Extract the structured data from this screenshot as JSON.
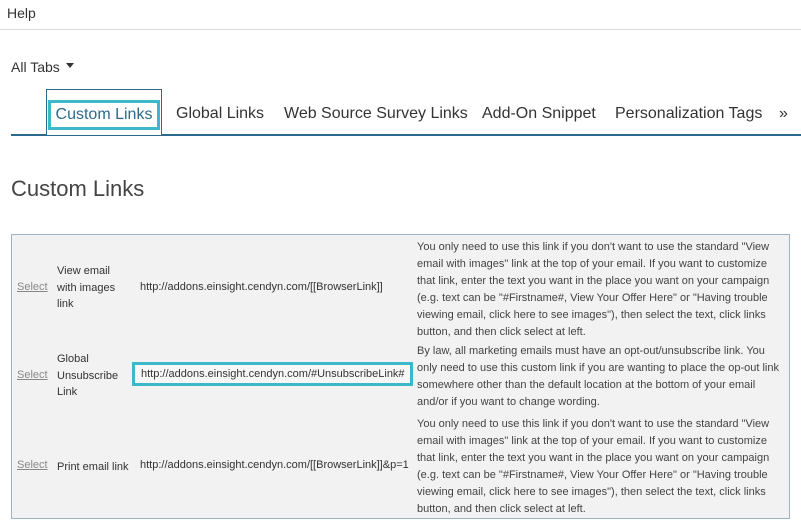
{
  "topbar": {
    "help_label": "Help"
  },
  "all_tabs": {
    "label": "All Tabs"
  },
  "tabs": [
    {
      "label": "Custom Links",
      "active": true
    },
    {
      "label": "Global Links"
    },
    {
      "label": "Web Source Survey Links"
    },
    {
      "label": "Add-On Snippet"
    },
    {
      "label": "Personalization Tags"
    },
    {
      "label": "»"
    }
  ],
  "page_title": "Custom Links",
  "links": [
    {
      "select_label": "Select",
      "name": "View email with images link",
      "url": "http://addons.einsight.cendyn.com/[[BrowserLink]]",
      "description": "You only need to use this link if you don't want to use the standard \"View email with images\" link at the top of your email. If you want to customize that link, enter the text you want in the place you want on your campaign (e.g. text can be \"#Firstname#, View Your Offer Here\" or \"Having trouble viewing email, click here to see images\"), then select the text, click links button, and then click select at left."
    },
    {
      "select_label": "Select",
      "name": "Global Unsubscribe Link",
      "url": "http://addons.einsight.cendyn.com/#UnsubscribeLink#",
      "description": "By law, all marketing emails must have an opt-out/unsubscribe link. You only need to use this custom link if you are wanting to place the op-out link somewhere other than the default location at the bottom of your email and/or if you want to change wording."
    },
    {
      "select_label": "Select",
      "name": "Print email link",
      "url": "http://addons.einsight.cendyn.com/[[BrowserLink]]&p=1",
      "description": "You only need to use this link if you don't want to use the standard \"View email with images\" link at the top of your email. If you want to customize that link, enter the text you want in the place you want on your campaign (e.g. text can be \"#Firstname#, View Your Offer Here\" or \"Having trouble viewing email, click here to see images\"), then select the text, click links button, and then click select at left."
    }
  ],
  "colors": {
    "accent": "#3cb8c9",
    "tab_border": "#2c6a8c",
    "table_bg": "#f2f2f2"
  }
}
